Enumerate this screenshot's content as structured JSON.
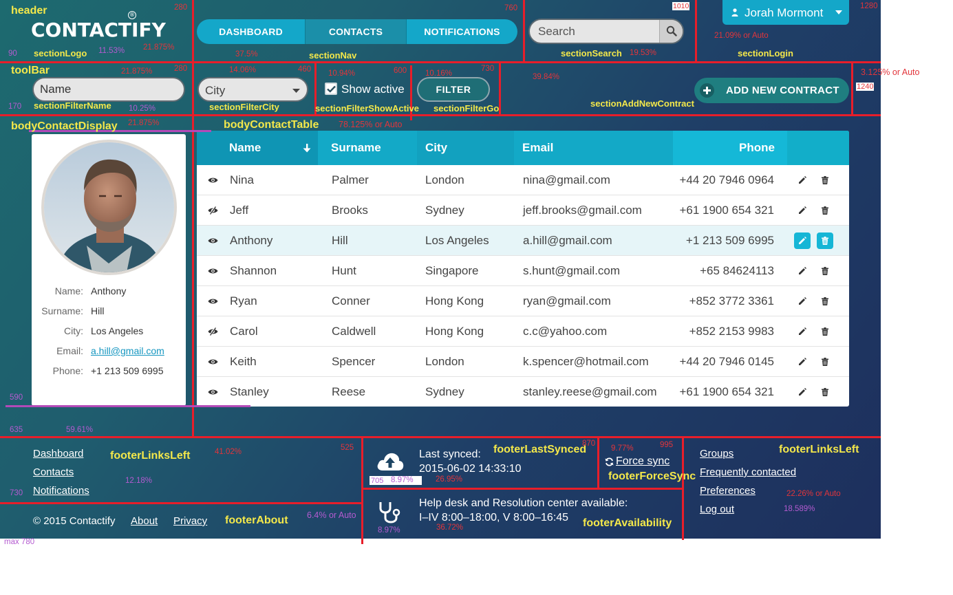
{
  "header": {
    "logo": "CONTACTIFY",
    "logo_mark": "®",
    "nav": [
      "DASHBOARD",
      "CONTACTS",
      "NOTIFICATIONS"
    ],
    "active_nav": "CONTACTS",
    "search_placeholder": "Search",
    "user_name": "Jorah Mormont"
  },
  "toolbar": {
    "name_placeholder": "Name",
    "city_value": "City",
    "show_active_label": "Show active",
    "show_active_checked": true,
    "filter_label": "FILTER",
    "add_label": "ADD NEW CONTRACT"
  },
  "contact_card": {
    "labels": {
      "name": "Name:",
      "surname": "Surname:",
      "city": "City:",
      "email": "Email:",
      "phone": "Phone:"
    },
    "values": {
      "name": "Anthony",
      "surname": "Hill",
      "city": "Los Angeles",
      "email": "a.hill@gmail.com",
      "phone": "+1 213 509 6995"
    }
  },
  "table": {
    "columns": [
      "Name",
      "Surname",
      "City",
      "Email",
      "Phone"
    ],
    "sort_column": "Name",
    "selected_row": 2,
    "rows": [
      {
        "active": true,
        "name": "Nina",
        "surname": "Palmer",
        "city": "London",
        "email": "nina@gmail.com",
        "phone": "+44 20 7946 0964"
      },
      {
        "active": false,
        "name": "Jeff",
        "surname": "Brooks",
        "city": "Sydney",
        "email": "jeff.brooks@gmail.com",
        "phone": "+61 1900 654 321"
      },
      {
        "active": true,
        "name": "Anthony",
        "surname": "Hill",
        "city": "Los Angeles",
        "email": "a.hill@gmail.com",
        "phone": "+1 213 509 6995"
      },
      {
        "active": true,
        "name": "Shannon",
        "surname": "Hunt",
        "city": "Singapore",
        "email": "s.hunt@gmail.com",
        "phone": "+65 84624113"
      },
      {
        "active": true,
        "name": "Ryan",
        "surname": "Conner",
        "city": "Hong Kong",
        "email": "ryan@gmail.com",
        "phone": "+852 3772 3361"
      },
      {
        "active": false,
        "name": "Carol",
        "surname": "Caldwell",
        "city": "Hong Kong",
        "email": "c.c@yahoo.com",
        "phone": "+852 2153 9983"
      },
      {
        "active": true,
        "name": "Keith",
        "surname": "Spencer",
        "city": "London",
        "email": "k.spencer@hotmail.com",
        "phone": "+44 20 7946 0145"
      },
      {
        "active": true,
        "name": "Stanley",
        "surname": "Reese",
        "city": "Sydney",
        "email": "stanley.reese@gmail.com",
        "phone": "+61 1900 654 321"
      }
    ]
  },
  "footer": {
    "links_left": [
      "Dashboard",
      "Contacts",
      "Notifications"
    ],
    "copyright": "© 2015 Contactify",
    "about": "About",
    "privacy": "Privacy",
    "last_synced_label": "Last synced:",
    "last_synced_value": "2015-06-02 14:33:10",
    "force_sync": "Force sync",
    "help_line1": "Help desk and Resolution center available:",
    "help_line2": "I–IV 8:00–18:00, V 8:00–16:45",
    "links_right": [
      "Groups",
      "Frequently contacted",
      "Preferences",
      "Log out"
    ]
  },
  "annotations": {
    "section_names": {
      "header": "header",
      "sectionLogo": "sectionLogo",
      "sectionNav": "sectionNav",
      "sectionSearch": "sectionSearch",
      "sectionLogin": "sectionLogin",
      "toolBar": "toolBar",
      "sectionFilterName": "sectionFilterName",
      "sectionFilterCity": "sectionFilterCity",
      "sectionFilterShowActive": "sectionFilterShowActive",
      "sectionFilterGo": "sectionFilterGo",
      "sectionAddNewContract": "sectionAddNewContract",
      "bodyContactDisplay": "bodyContactDisplay",
      "bodyContactTable": "bodyContactTable",
      "footerLinksLeft": "footerLinksLeft",
      "footerLastSynced": "footerLastSynced",
      "footerForceSync": "footerForceSync",
      "footerLinksRight": "footerLinksLeft",
      "footerAbout": "footerAbout",
      "footerAvailability": "footerAvailability"
    },
    "red_values": {
      "header_x": "280",
      "nav_x": "760",
      "search_x": "1010",
      "login_x": "1280",
      "logo_w": "21.875%",
      "nav_w": "37.5%",
      "search_w": "19.53%",
      "login_w": "21.09% or Auto",
      "tb_x": "280",
      "fn_w": "21.875%",
      "fc_x": "460",
      "fc_w": "14.06%",
      "fsa_x": "600",
      "fsa_w": "10.94%",
      "fg_x": "730",
      "fg_w": "10.16%",
      "anc_w": "39.84%",
      "right_w": "3.125% or Auto",
      "right_x": "1240",
      "bcd_w": "21.875%",
      "bct_w": "78.125% or Auto",
      "fll_x": "525",
      "fll_w": "41.02%",
      "fls_x": "870",
      "fls_w": "26.95%",
      "ffs_x": "995",
      "ffs_w": "9.77%",
      "flr_w": "22.26% or Auto",
      "fav_w": "36.72%"
    },
    "purple_values": {
      "h_top": "90",
      "logo_h": "11.53%",
      "tb_h": "170",
      "fn_h": "10.25%",
      "body_h": "590",
      "body_b": "635",
      "body_pct": "59.61%",
      "fll_h": "730",
      "fll_pct": "12.18%",
      "fab_pct": "6.4% or Auto",
      "max": "max 780",
      "fls_box": "705",
      "fls_pct": "8.97%",
      "fav_pct": "8.97%",
      "flr_pct": "18.589%"
    }
  }
}
